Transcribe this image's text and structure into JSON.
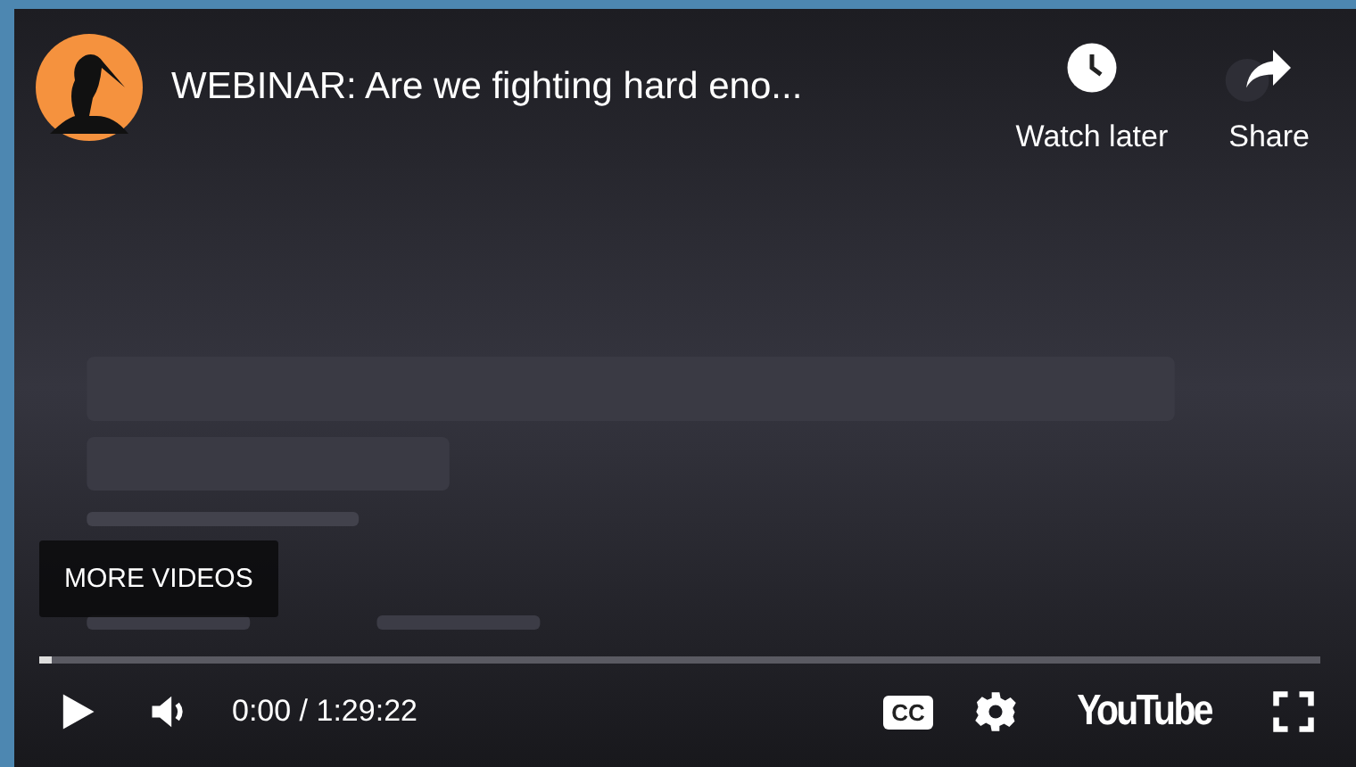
{
  "title": "WEBINAR: Are we fighting hard eno...",
  "top_actions": [
    {
      "kind": "clock",
      "label": "Watch later"
    },
    {
      "kind": "share",
      "label": "Share"
    }
  ],
  "more_videos": "MORE VIDEOS",
  "progress": {
    "level": 0.01
  },
  "time": "0:00 / 1:29:22",
  "captions_label": "CC",
  "logo_text": "YouTube"
}
